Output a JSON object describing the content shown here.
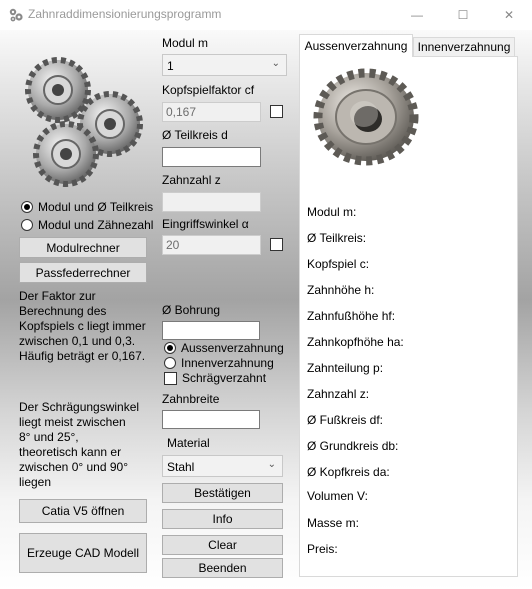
{
  "window": {
    "title": "Zahnraddimensionierungsprogramm",
    "controls": {
      "minimize": "—",
      "maximize": "☐",
      "close": "✕"
    }
  },
  "left": {
    "radio_teilkreis": "Modul und Ø Teilkreis",
    "radio_zaehnezahl": "Modul und Zähnezahl",
    "btn_modulrechner": "Modulrechner",
    "btn_passfeder": "Passfederrechner",
    "info_lines_1": [
      "Der Faktor zur",
      "Berechnung des",
      "Kopfspiels c liegt immer",
      "zwischen 0,1 und 0,3.",
      "Häufig beträgt er 0,167."
    ],
    "info_lines_2": [
      "Der Schrägungswinkel",
      "liegt meist zwischen",
      "8° und 25°,",
      "theoretisch kann er",
      "zwischen 0° und 90°",
      "liegen"
    ],
    "btn_catia": "Catia V5 öffnen",
    "btn_cad": "Erzeuge CAD Modell"
  },
  "middle": {
    "modul_label": "Modul m",
    "modul_value": "1",
    "kopfspiel_label": "Kopfspielfaktor cf",
    "kopfspiel_value": "0,167",
    "teilkreis_label": "Ø Teilkreis d",
    "teilkreis_value": "",
    "zahnzahl_label": "Zahnzahl z",
    "zahnzahl_value": "",
    "eingriff_label": "Eingriffswinkel α",
    "eingriff_value": "20",
    "bohrung_label": "Ø Bohrung",
    "bohrung_value": "",
    "radio_aussen": "Aussenverzahnung",
    "radio_innen": "Innenverzahnung",
    "check_schraeg": "Schrägverzahnt",
    "zahnbreite_label": "Zahnbreite",
    "zahnbreite_value": "",
    "material_label": "Material",
    "material_value": "Stahl",
    "btn_bestaetigen": "Bestätigen",
    "btn_info": "Info",
    "btn_clear": "Clear",
    "btn_beenden": "Beenden"
  },
  "tabs": {
    "aussen": "Aussenverzahnung",
    "innen": "Innenverzahnung"
  },
  "results": [
    "Modul m:",
    "Ø Teilkreis:",
    "Kopfspiel c:",
    "Zahnhöhe h:",
    "Zahnfußhöhe hf:",
    "Zahnkopfhöhe ha:",
    "Zahnteilung p:",
    "Zahnzahl z:",
    "Ø Fußkreis df:",
    "Ø Grundkreis db:",
    "Ø Kopfkreis da:",
    "Volumen V:",
    "Masse m:",
    "Preis:"
  ]
}
